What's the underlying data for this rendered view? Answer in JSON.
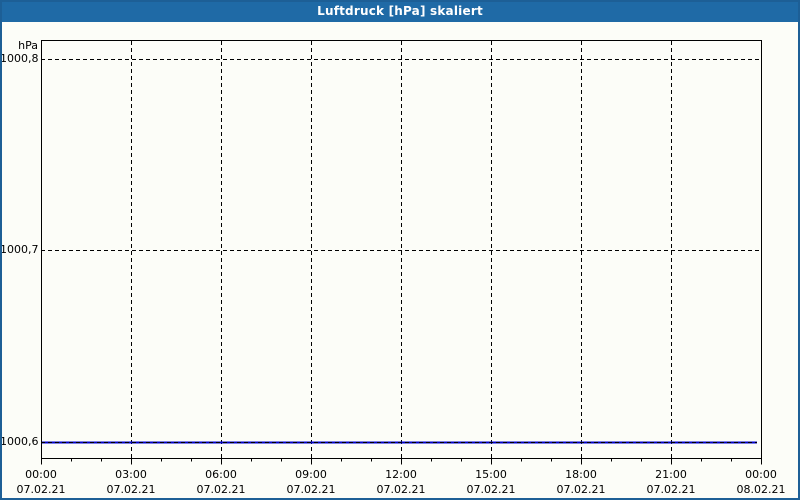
{
  "window": {
    "title": "Luftdruck [hPa] skaliert"
  },
  "axes": {
    "y_unit": "hPa",
    "y_ticks": [
      {
        "label": "1000,8",
        "value": 1000.8
      },
      {
        "label": "1000,7",
        "value": 1000.7
      },
      {
        "label": "1000,6",
        "value": 1000.6
      }
    ],
    "x_ticks": [
      {
        "time": "00:00",
        "date": "07.02.21"
      },
      {
        "time": "03:00",
        "date": "07.02.21"
      },
      {
        "time": "06:00",
        "date": "07.02.21"
      },
      {
        "time": "09:00",
        "date": "07.02.21"
      },
      {
        "time": "12:00",
        "date": "07.02.21"
      },
      {
        "time": "15:00",
        "date": "07.02.21"
      },
      {
        "time": "18:00",
        "date": "07.02.21"
      },
      {
        "time": "21:00",
        "date": "07.02.21"
      },
      {
        "time": "00:00",
        "date": "08.02.21"
      }
    ]
  },
  "colors": {
    "titlebar": "#1f6aa6",
    "window_frame": "#1d5f96",
    "background": "#fcfdf8",
    "grid": "#000000",
    "series": "#0000cc",
    "title_text": "#ffffff"
  },
  "chart_data": {
    "type": "line",
    "title": "Luftdruck [hPa] skaliert",
    "xlabel": "",
    "ylabel": "hPa",
    "x": [
      "07.02.21 00:00",
      "07.02.21 03:00",
      "07.02.21 06:00",
      "07.02.21 09:00",
      "07.02.21 12:00",
      "07.02.21 15:00",
      "07.02.21 18:00",
      "07.02.21 21:00",
      "08.02.21 00:00"
    ],
    "series": [
      {
        "name": "Luftdruck [hPa]",
        "color": "#0000cc",
        "values": [
          1000.6,
          1000.6,
          1000.6,
          1000.6,
          1000.6,
          1000.6,
          1000.6,
          1000.6,
          1000.6
        ]
      }
    ],
    "ylim": [
      1000.59,
      1000.81
    ],
    "y_gridlines": [
      1000.8,
      1000.7,
      1000.6
    ],
    "grid": "dashed",
    "legend_position": "none",
    "major_x_tick_interval_hours": 3,
    "minor_x_tick_interval_hours": 1
  }
}
